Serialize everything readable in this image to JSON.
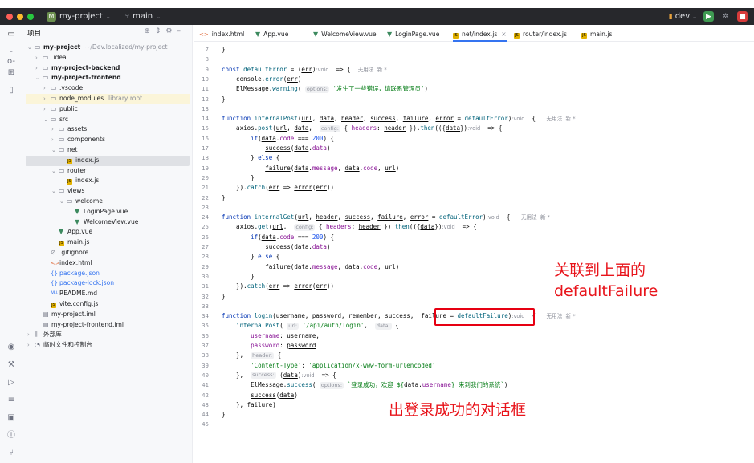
{
  "titlebar": {
    "project_badge": "M",
    "project": "my-project",
    "branch": "main",
    "right_branch": "dev"
  },
  "colors": {
    "traffic_red": "#ff5f57",
    "traffic_yellow": "#febc2e",
    "traffic_green": "#28c840",
    "tab_active_underline": "#3574f0",
    "annotation_red": "#e8141b"
  },
  "project_panel": {
    "title": "项目",
    "tree": [
      {
        "label": "my-project",
        "suffix": "~/Dev.localized/my-project",
        "icon": "folder-icon",
        "arrow": "down",
        "bold": true
      },
      {
        "label": ".idea",
        "icon": "folder-icon",
        "arrow": "right"
      },
      {
        "label": "my-project-backend",
        "icon": "folder-icon",
        "arrow": "right",
        "bold": true
      },
      {
        "label": "my-project-frontend",
        "icon": "folder-icon",
        "arrow": "down",
        "bold": true
      },
      {
        "label": ".vscode",
        "icon": "folder-icon",
        "arrow": "right"
      },
      {
        "label": "node_modules",
        "suffix": "library root",
        "icon": "folder-icon",
        "arrow": "right",
        "lib": true
      },
      {
        "label": "public",
        "icon": "folder-icon",
        "arrow": "right"
      },
      {
        "label": "src",
        "icon": "folder-icon",
        "arrow": "down"
      },
      {
        "label": "assets",
        "icon": "folder-icon",
        "arrow": "right"
      },
      {
        "label": "components",
        "icon": "folder-icon",
        "arrow": "right"
      },
      {
        "label": "net",
        "icon": "folder-icon",
        "arrow": "down"
      },
      {
        "label": "index.js",
        "icon": "js-file-icon",
        "selected": true
      },
      {
        "label": "router",
        "icon": "folder-icon",
        "arrow": "down"
      },
      {
        "label": "index.js",
        "icon": "js-file-icon"
      },
      {
        "label": "views",
        "icon": "folder-icon",
        "arrow": "down"
      },
      {
        "label": "welcome",
        "icon": "folder-icon",
        "arrow": "down"
      },
      {
        "label": "LoginPage.vue",
        "icon": "vue-file-icon"
      },
      {
        "label": "WelcomeView.vue",
        "icon": "vue-file-icon"
      },
      {
        "label": "App.vue",
        "icon": "vue-file-icon"
      },
      {
        "label": "main.js",
        "icon": "js-file-icon"
      },
      {
        "label": ".gitignore",
        "icon": "gitignore-icon"
      },
      {
        "label": "index.html",
        "icon": "html-file-icon"
      },
      {
        "label": "package.json",
        "icon": "json-file-icon",
        "blue": true
      },
      {
        "label": "package-lock.json",
        "icon": "json-file-icon",
        "blue": true
      },
      {
        "label": "README.md",
        "icon": "markdown-file-icon"
      },
      {
        "label": "vite.config.js",
        "icon": "js-file-icon"
      },
      {
        "label": "my-project.iml",
        "icon": "iml-file-icon"
      },
      {
        "label": "my-project-frontend.iml",
        "icon": "iml-file-icon"
      },
      {
        "label": "外部库",
        "icon": "library-icon",
        "arrow": "right"
      },
      {
        "label": "临时文件和控制台",
        "icon": "scratch-icon",
        "arrow": "right"
      }
    ]
  },
  "editor_tabs": [
    {
      "label": "index.html",
      "icon": "html-file-icon"
    },
    {
      "label": "App.vue",
      "icon": "vue-file-icon"
    },
    {
      "label": "WelcomeView.vue",
      "icon": "vue-file-icon"
    },
    {
      "label": "LoginPage.vue",
      "icon": "vue-file-icon"
    },
    {
      "label": "net/index.js",
      "icon": "js-file-icon",
      "active": true,
      "close": "×"
    },
    {
      "label": "router/index.js",
      "icon": "js-file-icon"
    },
    {
      "label": "main.js",
      "icon": "js-file-icon"
    }
  ],
  "editor": {
    "line_numbers": [
      "7",
      "8",
      "9",
      "10",
      "11",
      "12",
      "13",
      "14",
      "15",
      "16",
      "17",
      "18",
      "19",
      "20",
      "21",
      "22",
      "23",
      "24",
      "25",
      "26",
      "27",
      "28",
      "29",
      "30",
      "31",
      "32",
      "33",
      "34",
      "35",
      "36",
      "37",
      "38",
      "39",
      "40",
      "41",
      "42",
      "43",
      "44",
      "45"
    ],
    "lines": [
      [
        {
          "t": "}"
        }
      ],
      [],
      [
        {
          "t": "const ",
          "c": "kw"
        },
        {
          "t": "defaultError",
          "c": "fn"
        },
        {
          "t": " = ("
        },
        {
          "t": "err",
          "c": "ul"
        },
        {
          "t": ")"
        },
        {
          "t": ":void",
          "c": "meta"
        },
        {
          "t": "  => {  "
        },
        {
          "t": "无用法  新 *",
          "c": "meta"
        }
      ],
      [
        {
          "t": "    console."
        },
        {
          "t": "error",
          "c": "fn"
        },
        {
          "t": "("
        },
        {
          "t": "err",
          "c": "ul"
        },
        {
          "t": ")"
        }
      ],
      [
        {
          "t": "    ElMessage."
        },
        {
          "t": "warning",
          "c": "fn"
        },
        {
          "t": "( "
        },
        {
          "t": "options:",
          "c": "hint"
        },
        {
          "t": " "
        },
        {
          "t": "'发生了一些错误，请联系管理员'",
          "c": "str"
        },
        {
          "t": ")"
        }
      ],
      [
        {
          "t": "}"
        }
      ],
      [],
      [
        {
          "t": "function ",
          "c": "kw"
        },
        {
          "t": "internalPost",
          "c": "fn"
        },
        {
          "t": "("
        },
        {
          "t": "url",
          "c": "ul"
        },
        {
          "t": ", "
        },
        {
          "t": "data",
          "c": "ul"
        },
        {
          "t": ", "
        },
        {
          "t": "header",
          "c": "ul"
        },
        {
          "t": ", "
        },
        {
          "t": "success",
          "c": "ul"
        },
        {
          "t": ", "
        },
        {
          "t": "failure",
          "c": "ul"
        },
        {
          "t": ", "
        },
        {
          "t": "error",
          "c": "ul"
        },
        {
          "t": " = "
        },
        {
          "t": "defaultError",
          "c": "fn"
        },
        {
          "t": ")"
        },
        {
          "t": ":void",
          "c": "meta"
        },
        {
          "t": "  {   "
        },
        {
          "t": "无用法  新 *",
          "c": "meta"
        }
      ],
      [
        {
          "t": "    axios."
        },
        {
          "t": "post",
          "c": "fn"
        },
        {
          "t": "("
        },
        {
          "t": "url",
          "c": "ul"
        },
        {
          "t": ", "
        },
        {
          "t": "data",
          "c": "ul"
        },
        {
          "t": ",  "
        },
        {
          "t": "config:",
          "c": "hint"
        },
        {
          "t": " { "
        },
        {
          "t": "headers",
          "c": "prop"
        },
        {
          "t": ": "
        },
        {
          "t": "header",
          "c": "ul"
        },
        {
          "t": " })."
        },
        {
          "t": "then",
          "c": "fn"
        },
        {
          "t": "(({"
        },
        {
          "t": "data",
          "c": "ul"
        },
        {
          "t": "})"
        },
        {
          "t": ":void",
          "c": "meta"
        },
        {
          "t": "  => {"
        }
      ],
      [
        {
          "t": "        "
        },
        {
          "t": "if",
          "c": "kw"
        },
        {
          "t": "("
        },
        {
          "t": "data",
          "c": "ul"
        },
        {
          "t": "."
        },
        {
          "t": "code",
          "c": "prop"
        },
        {
          "t": " === "
        },
        {
          "t": "200",
          "c": "num"
        },
        {
          "t": ") {"
        }
      ],
      [
        {
          "t": "            "
        },
        {
          "t": "success",
          "c": "ul"
        },
        {
          "t": "("
        },
        {
          "t": "data",
          "c": "ul"
        },
        {
          "t": "."
        },
        {
          "t": "data",
          "c": "prop"
        },
        {
          "t": ")"
        }
      ],
      [
        {
          "t": "        } "
        },
        {
          "t": "else",
          "c": "kw"
        },
        {
          "t": " {"
        }
      ],
      [
        {
          "t": "            "
        },
        {
          "t": "failure",
          "c": "ul"
        },
        {
          "t": "("
        },
        {
          "t": "data",
          "c": "ul"
        },
        {
          "t": "."
        },
        {
          "t": "message",
          "c": "prop"
        },
        {
          "t": ", "
        },
        {
          "t": "data",
          "c": "ul"
        },
        {
          "t": "."
        },
        {
          "t": "code",
          "c": "prop"
        },
        {
          "t": ", "
        },
        {
          "t": "url",
          "c": "ul"
        },
        {
          "t": ")"
        }
      ],
      [
        {
          "t": "        }"
        }
      ],
      [
        {
          "t": "    })."
        },
        {
          "t": "catch",
          "c": "fn"
        },
        {
          "t": "("
        },
        {
          "t": "err",
          "c": "ul"
        },
        {
          "t": " => "
        },
        {
          "t": "error",
          "c": "ul"
        },
        {
          "t": "("
        },
        {
          "t": "err",
          "c": "ul"
        },
        {
          "t": "))"
        }
      ],
      [
        {
          "t": "}"
        }
      ],
      [],
      [
        {
          "t": "function ",
          "c": "kw"
        },
        {
          "t": "internalGet",
          "c": "fn"
        },
        {
          "t": "("
        },
        {
          "t": "url",
          "c": "ul"
        },
        {
          "t": ", "
        },
        {
          "t": "header",
          "c": "ul"
        },
        {
          "t": ", "
        },
        {
          "t": "success",
          "c": "ul"
        },
        {
          "t": ", "
        },
        {
          "t": "failure",
          "c": "ul"
        },
        {
          "t": ", "
        },
        {
          "t": "error",
          "c": "ul"
        },
        {
          "t": " = "
        },
        {
          "t": "defaultError",
          "c": "fn"
        },
        {
          "t": ")"
        },
        {
          "t": ":void",
          "c": "meta"
        },
        {
          "t": "  {   "
        },
        {
          "t": "无用法  新 *",
          "c": "meta"
        }
      ],
      [
        {
          "t": "    axios."
        },
        {
          "t": "get",
          "c": "fn"
        },
        {
          "t": "("
        },
        {
          "t": "url",
          "c": "ul"
        },
        {
          "t": ",  "
        },
        {
          "t": "config:",
          "c": "hint"
        },
        {
          "t": " { "
        },
        {
          "t": "headers",
          "c": "prop"
        },
        {
          "t": ": "
        },
        {
          "t": "header",
          "c": "ul"
        },
        {
          "t": " })."
        },
        {
          "t": "then",
          "c": "fn"
        },
        {
          "t": "(({"
        },
        {
          "t": "data",
          "c": "ul"
        },
        {
          "t": "})"
        },
        {
          "t": ":void",
          "c": "meta"
        },
        {
          "t": "  => {"
        }
      ],
      [
        {
          "t": "        "
        },
        {
          "t": "if",
          "c": "kw"
        },
        {
          "t": "("
        },
        {
          "t": "data",
          "c": "ul"
        },
        {
          "t": "."
        },
        {
          "t": "code",
          "c": "prop"
        },
        {
          "t": " === "
        },
        {
          "t": "200",
          "c": "num"
        },
        {
          "t": ") {"
        }
      ],
      [
        {
          "t": "            "
        },
        {
          "t": "success",
          "c": "ul"
        },
        {
          "t": "("
        },
        {
          "t": "data",
          "c": "ul"
        },
        {
          "t": "."
        },
        {
          "t": "data",
          "c": "prop"
        },
        {
          "t": ")"
        }
      ],
      [
        {
          "t": "        } "
        },
        {
          "t": "else",
          "c": "kw"
        },
        {
          "t": " {"
        }
      ],
      [
        {
          "t": "            "
        },
        {
          "t": "failure",
          "c": "ul"
        },
        {
          "t": "("
        },
        {
          "t": "data",
          "c": "ul"
        },
        {
          "t": "."
        },
        {
          "t": "message",
          "c": "prop"
        },
        {
          "t": ", "
        },
        {
          "t": "data",
          "c": "ul"
        },
        {
          "t": "."
        },
        {
          "t": "code",
          "c": "prop"
        },
        {
          "t": ", "
        },
        {
          "t": "url",
          "c": "ul"
        },
        {
          "t": ")"
        }
      ],
      [
        {
          "t": "        }"
        }
      ],
      [
        {
          "t": "    })."
        },
        {
          "t": "catch",
          "c": "fn"
        },
        {
          "t": "("
        },
        {
          "t": "err",
          "c": "ul"
        },
        {
          "t": " => "
        },
        {
          "t": "error",
          "c": "ul"
        },
        {
          "t": "("
        },
        {
          "t": "err",
          "c": "ul"
        },
        {
          "t": "))"
        }
      ],
      [
        {
          "t": "}"
        }
      ],
      [],
      [
        {
          "t": "function ",
          "c": "kw"
        },
        {
          "t": "login",
          "c": "fn"
        },
        {
          "t": "("
        },
        {
          "t": "username",
          "c": "ul"
        },
        {
          "t": ", "
        },
        {
          "t": "password",
          "c": "ul"
        },
        {
          "t": ", "
        },
        {
          "t": "remember",
          "c": "ul"
        },
        {
          "t": ", "
        },
        {
          "t": "success",
          "c": "ul"
        },
        {
          "t": ",  "
        },
        {
          "t": "failure",
          "c": "ul"
        },
        {
          "t": " = "
        },
        {
          "t": "defaultFailure",
          "c": "fn"
        },
        {
          "t": ")"
        },
        {
          "t": ":void",
          "c": "meta"
        },
        {
          "t": "  {   "
        },
        {
          "t": "无用法  新 *",
          "c": "meta"
        }
      ],
      [
        {
          "t": "    "
        },
        {
          "t": "internalPost",
          "c": "fn"
        },
        {
          "t": "( "
        },
        {
          "t": "url:",
          "c": "hint"
        },
        {
          "t": " "
        },
        {
          "t": "'/api/auth/login'",
          "c": "str"
        },
        {
          "t": ",  "
        },
        {
          "t": "data:",
          "c": "hint"
        },
        {
          "t": " {"
        }
      ],
      [
        {
          "t": "        "
        },
        {
          "t": "username",
          "c": "prop"
        },
        {
          "t": ": "
        },
        {
          "t": "username",
          "c": "ul"
        },
        {
          "t": ","
        }
      ],
      [
        {
          "t": "        "
        },
        {
          "t": "password",
          "c": "prop"
        },
        {
          "t": ": "
        },
        {
          "t": "password",
          "c": "ul"
        }
      ],
      [
        {
          "t": "    },  "
        },
        {
          "t": "header:",
          "c": "hint"
        },
        {
          "t": " {"
        }
      ],
      [
        {
          "t": "        "
        },
        {
          "t": "'Content-Type'",
          "c": "str"
        },
        {
          "t": ": "
        },
        {
          "t": "'application/x-www-form-urlencoded'",
          "c": "str"
        }
      ],
      [
        {
          "t": "    },  "
        },
        {
          "t": "success:",
          "c": "hint"
        },
        {
          "t": " ("
        },
        {
          "t": "data",
          "c": "ul"
        },
        {
          "t": ")"
        },
        {
          "t": ":void",
          "c": "meta"
        },
        {
          "t": "  => {"
        }
      ],
      [
        {
          "t": "        ElMessage."
        },
        {
          "t": "success",
          "c": "fn"
        },
        {
          "t": "( "
        },
        {
          "t": "options:",
          "c": "hint"
        },
        {
          "t": " "
        },
        {
          "t": "`登录成功，欢迎 ${",
          "c": "str"
        },
        {
          "t": "data",
          "c": "ul"
        },
        {
          "t": "."
        },
        {
          "t": "username",
          "c": "prop"
        },
        {
          "t": "} 来到我们的系统`",
          "c": "str"
        },
        {
          "t": ")"
        }
      ],
      [
        {
          "t": "        "
        },
        {
          "t": "success",
          "c": "ul"
        },
        {
          "t": "("
        },
        {
          "t": "data",
          "c": "ul"
        },
        {
          "t": ")"
        }
      ],
      [
        {
          "t": "    }, "
        },
        {
          "t": "failure",
          "c": "ul"
        },
        {
          "t": ")"
        }
      ],
      [
        {
          "t": "}"
        }
      ],
      []
    ]
  },
  "annotations": {
    "link_line1": "关联到上面的",
    "link_line2": "defaultFailure",
    "dialog_note": "出登录成功的对话框"
  }
}
